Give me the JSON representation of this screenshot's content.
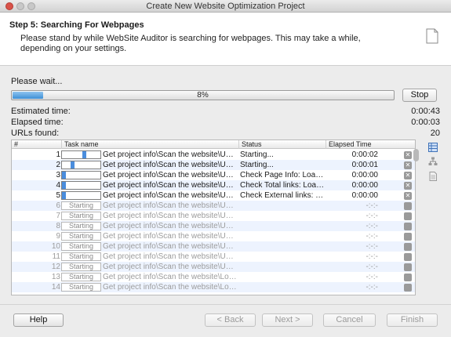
{
  "window": {
    "title": "Create New Website Optimization Project"
  },
  "header": {
    "step_title": "Step 5: Searching For Webpages",
    "description": "Please stand by while WebSite Auditor is searching for webpages. This may take a while, depending on your settings."
  },
  "progress": {
    "label": "Please wait...",
    "percent_text": "8%",
    "value": 0.08,
    "stop_label": "Stop"
  },
  "stats": {
    "estimated_label": "Estimated time:",
    "estimated_value": "0:00:43",
    "elapsed_label": "Elapsed time:",
    "elapsed_value": "0:00:03",
    "urls_label": "URLs found:",
    "urls_value": "20"
  },
  "table": {
    "columns": [
      "#",
      "Task name",
      "Status",
      "Elapsed Time"
    ],
    "rows": [
      {
        "num": "1",
        "task": "Get project info\\Scan the website\\Update...",
        "status": "Starting...",
        "elapsed": "0:00:02",
        "bar": "active",
        "seg": 0.58
      },
      {
        "num": "2",
        "task": "Get project info\\Scan the website\\Update...",
        "status": "Starting...",
        "elapsed": "0:00:01",
        "bar": "active",
        "seg": 0.25
      },
      {
        "num": "3",
        "task": "Get project info\\Scan the website\\Update...",
        "status": "Check Page Info: Loading...",
        "elapsed": "0:00:00",
        "bar": "active",
        "seg": 0.0
      },
      {
        "num": "4",
        "task": "Get project info\\Scan the website\\Update...",
        "status": "Check Total links: Loadin...",
        "elapsed": "0:00:00",
        "bar": "active",
        "seg": 0.0
      },
      {
        "num": "5",
        "task": "Get project info\\Scan the website\\Update...",
        "status": "Check External links: Loa...",
        "elapsed": "0:00:00",
        "bar": "active",
        "seg": 0.0
      },
      {
        "num": "6",
        "task": "Get project info\\Scan the website\\Update...",
        "status": "",
        "elapsed": "-:-:-",
        "bar": "Starting"
      },
      {
        "num": "7",
        "task": "Get project info\\Scan the website\\Update...",
        "status": "",
        "elapsed": "-:-:-",
        "bar": "Starting"
      },
      {
        "num": "8",
        "task": "Get project info\\Scan the website\\Update...",
        "status": "",
        "elapsed": "-:-:-",
        "bar": "Starting"
      },
      {
        "num": "9",
        "task": "Get project info\\Scan the website\\Update...",
        "status": "",
        "elapsed": "-:-:-",
        "bar": "Starting"
      },
      {
        "num": "10",
        "task": "Get project info\\Scan the website\\Update...",
        "status": "",
        "elapsed": "-:-:-",
        "bar": "Starting"
      },
      {
        "num": "11",
        "task": "Get project info\\Scan the website\\Update...",
        "status": "",
        "elapsed": "-:-:-",
        "bar": "Starting"
      },
      {
        "num": "12",
        "task": "Get project info\\Scan the website\\Update...",
        "status": "",
        "elapsed": "-:-:-",
        "bar": "Starting"
      },
      {
        "num": "13",
        "task": "Get project info\\Scan the website\\Load p...",
        "status": "",
        "elapsed": "-:-:-",
        "bar": "Starting"
      },
      {
        "num": "14",
        "task": "Get project info\\Scan the website\\Load p...",
        "status": "",
        "elapsed": "-:-:-",
        "bar": "Starting"
      }
    ]
  },
  "footer": {
    "help": "Help",
    "back": "< Back",
    "next": "Next >",
    "cancel": "Cancel",
    "finish": "Finish"
  },
  "icons": [
    "document-icon",
    "table-view-icon",
    "sitemap-icon",
    "page-icon"
  ]
}
